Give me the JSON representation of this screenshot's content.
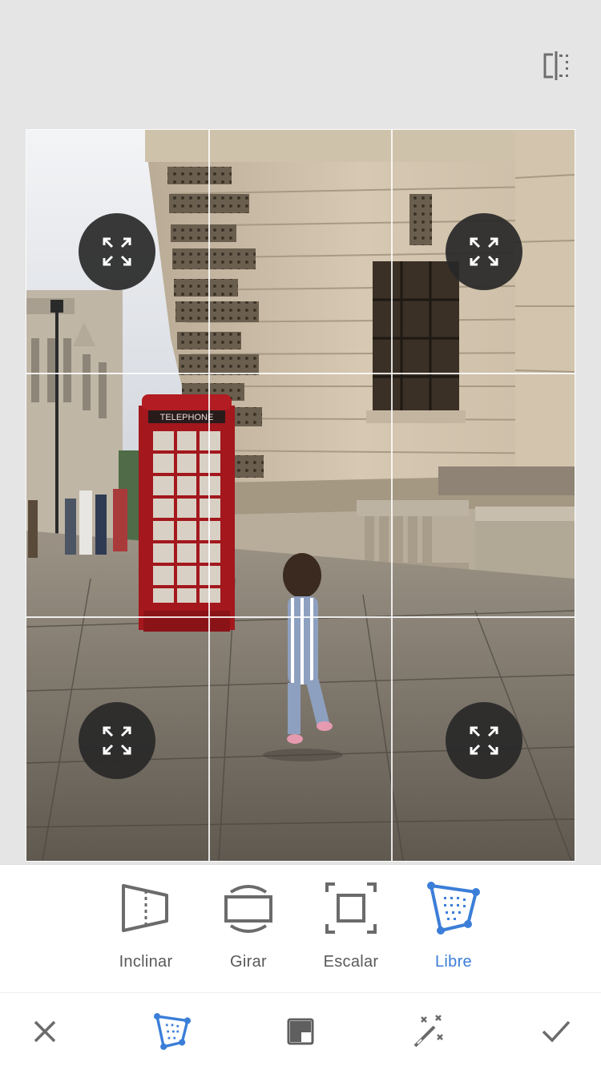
{
  "tools": [
    {
      "label": "Inclinar",
      "icon": "perspective-tilt-icon",
      "active": false
    },
    {
      "label": "Girar",
      "icon": "rotate-icon",
      "active": false
    },
    {
      "label": "Escalar",
      "icon": "scale-icon",
      "active": false
    },
    {
      "label": "Libre",
      "icon": "free-transform-icon",
      "active": true
    }
  ],
  "bottom_bar": {
    "cancel": "close-icon",
    "mode": "free-transform-icon",
    "style": "style-square-icon",
    "auto": "magic-wand-icon",
    "apply": "checkmark-icon"
  },
  "photo": {
    "booth_sign": "TELEPHONE"
  },
  "colors": {
    "accent": "#3b7ed8",
    "label": "#595959",
    "background": "#e5e5e5"
  }
}
